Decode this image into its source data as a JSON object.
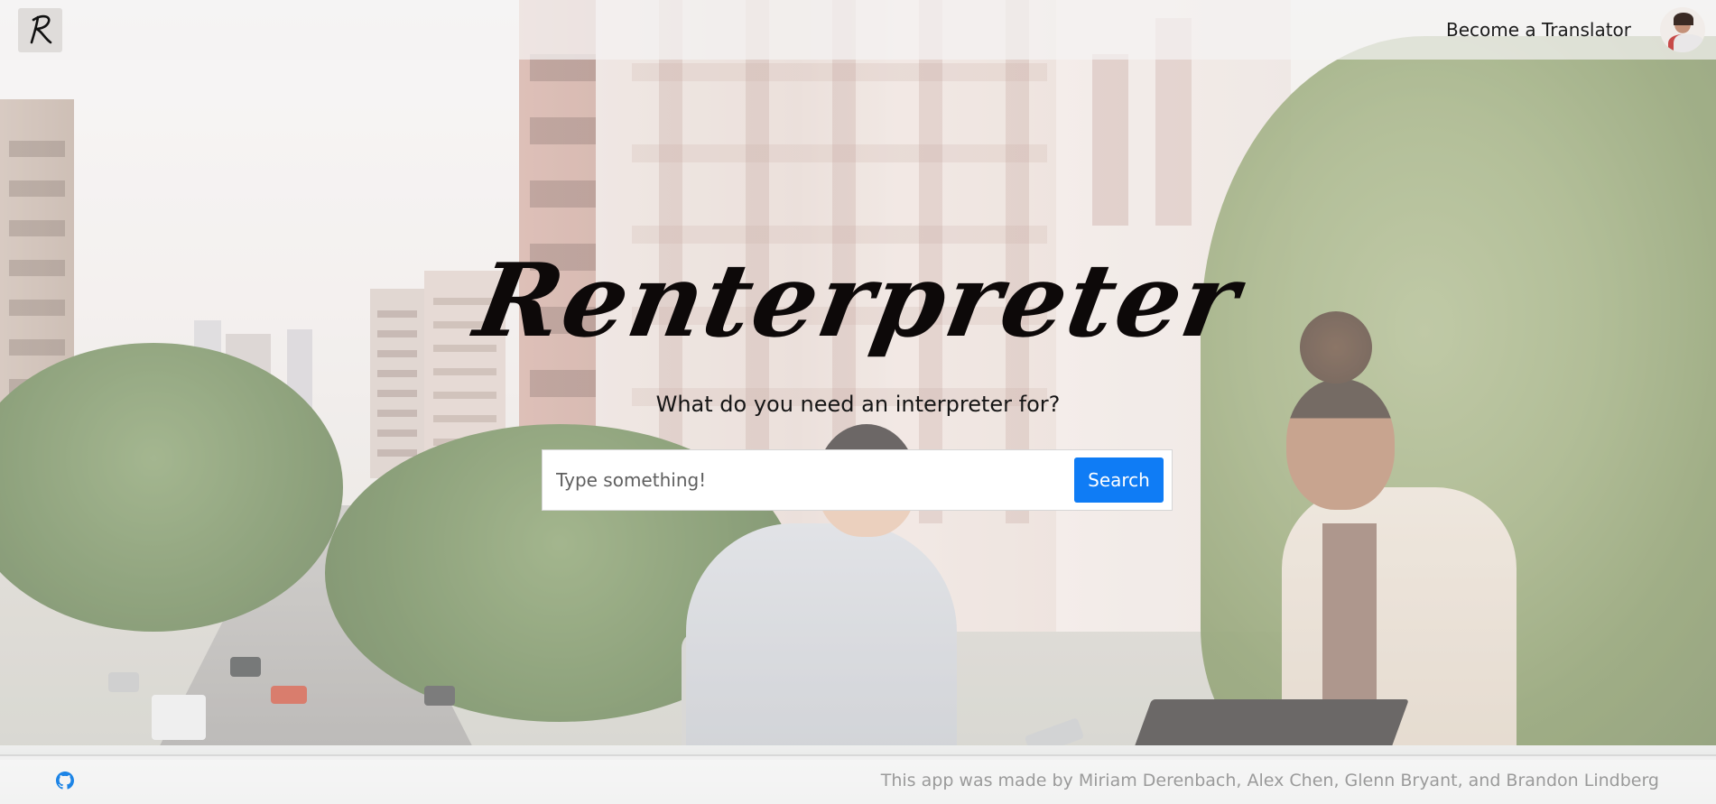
{
  "navbar": {
    "logo_letter": "R",
    "become_translator": "Become a Translator",
    "avatar_icon": "user-avatar"
  },
  "hero": {
    "title": "Renterpreter",
    "subtitle": "What do you need an interpreter for?"
  },
  "search": {
    "placeholder": "Type something!",
    "value": "",
    "button_label": "Search"
  },
  "footer": {
    "icon": "github-icon",
    "credit": "This app was made by Miriam Derenbach, Alex Chen, Glenn Bryant, and Brandon Lindberg"
  },
  "colors": {
    "accent": "#0f7cf5",
    "footer_text": "#9a9a9a",
    "github_icon": "#1c84e6"
  }
}
